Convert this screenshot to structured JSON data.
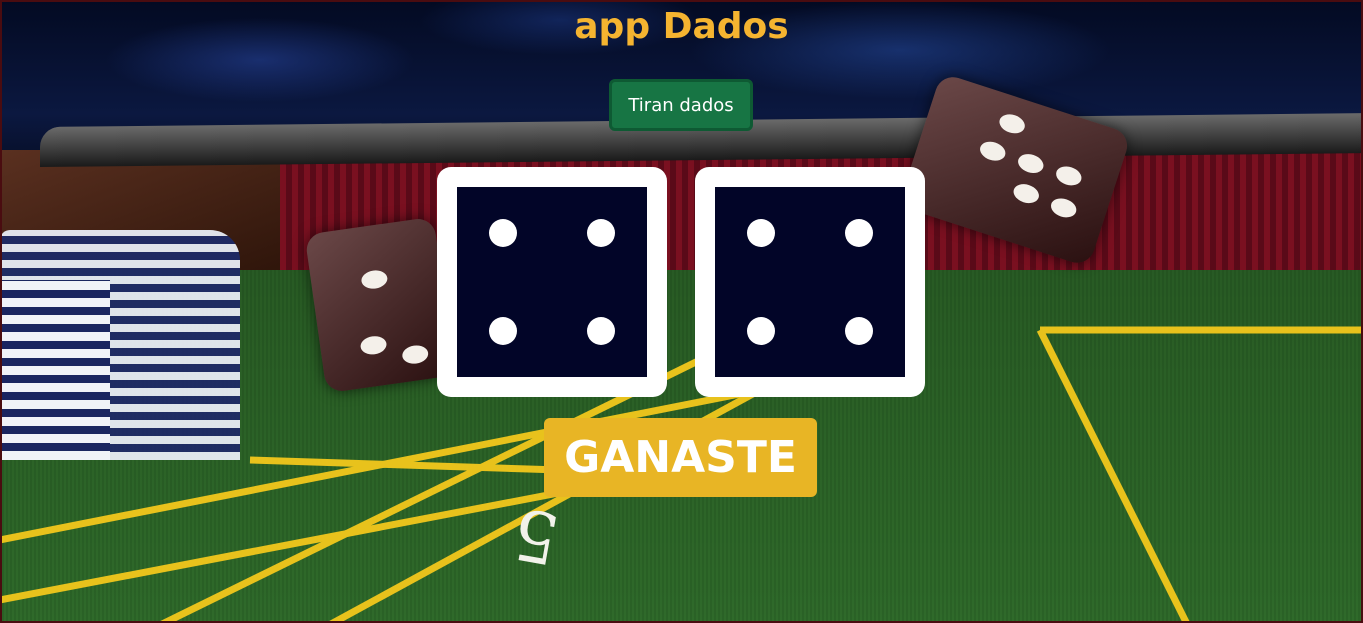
{
  "app": {
    "title": "app Dados"
  },
  "controls": {
    "roll_label": "Tiran dados"
  },
  "dice": [
    {
      "value": 4
    },
    {
      "value": 4
    }
  ],
  "result": {
    "text": "GANASTE"
  },
  "colors": {
    "title": "#f5b430",
    "button": "#177544",
    "die_face": "#020528",
    "result_badge": "#e8b525"
  },
  "icons": {
    "background": "casino-craps-table-photo"
  }
}
